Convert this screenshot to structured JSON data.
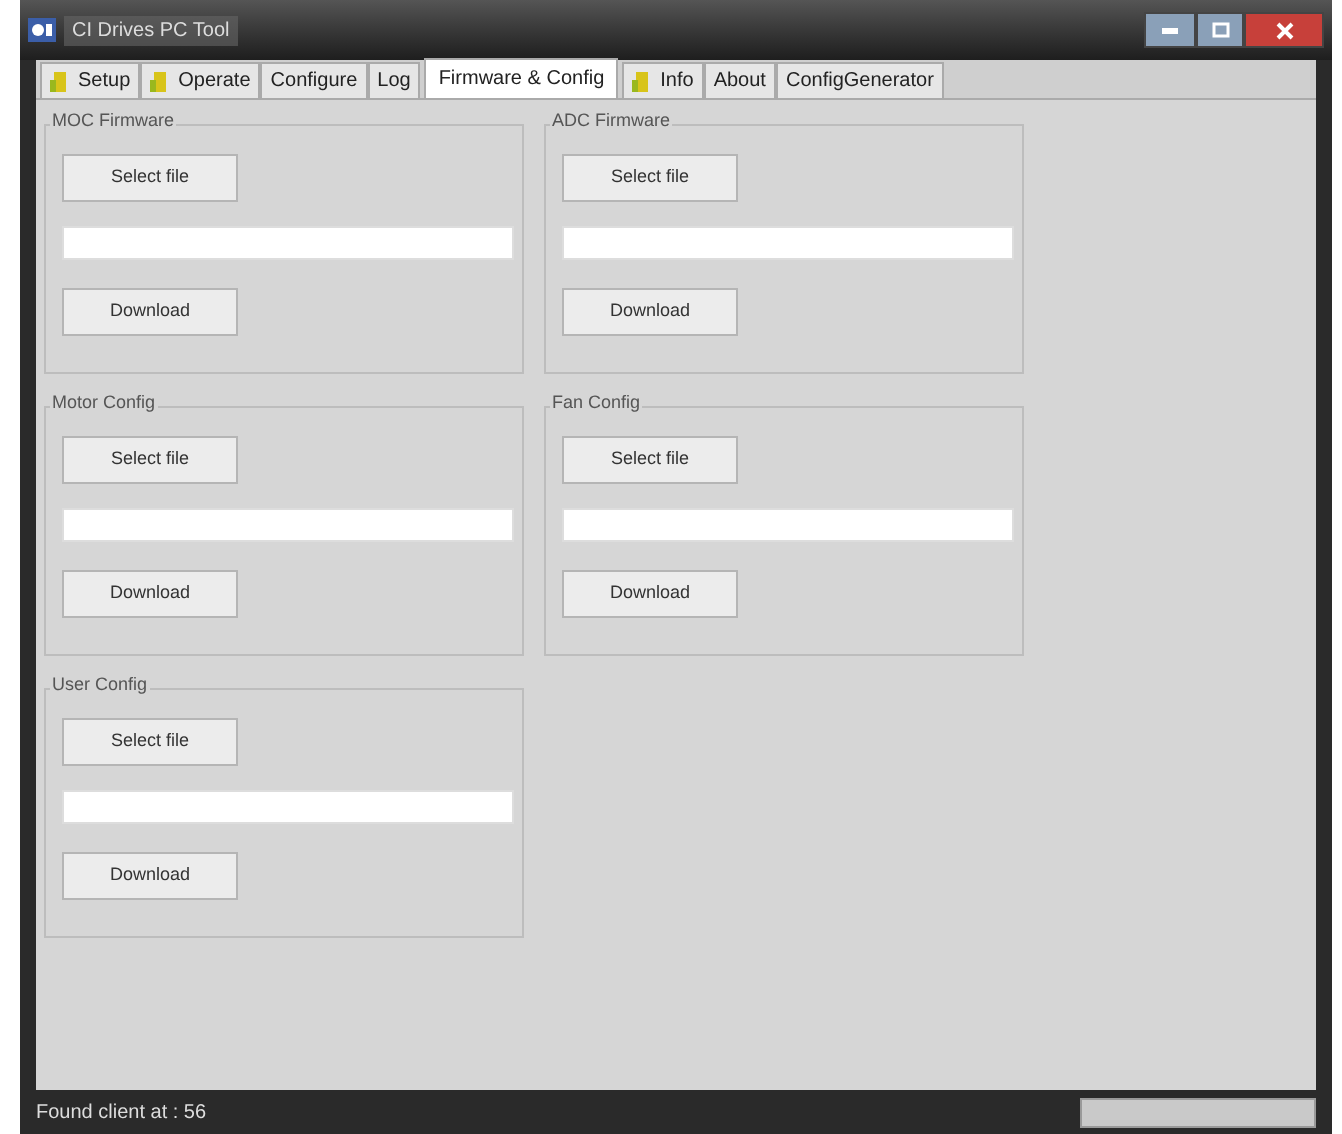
{
  "window": {
    "title": "CI Drives PC Tool"
  },
  "tabs": [
    {
      "label": "Setup",
      "selected": false,
      "icon": true
    },
    {
      "label": "Operate",
      "selected": false,
      "icon": true
    },
    {
      "label": "Configure",
      "selected": false,
      "icon": false
    },
    {
      "label": "Log",
      "selected": false,
      "icon": false
    },
    {
      "label": "Firmware & Config",
      "selected": true,
      "icon": false
    },
    {
      "label": "Info",
      "selected": false,
      "icon": true
    },
    {
      "label": "About",
      "selected": false,
      "icon": false
    },
    {
      "label": "ConfigGenerator",
      "selected": false,
      "icon": false
    }
  ],
  "panels": [
    {
      "title": "MOC Firmware",
      "select_button": "Select file",
      "download_button": "Download"
    },
    {
      "title": "ADC Firmware",
      "select_button": "Select file",
      "download_button": "Download"
    },
    {
      "title": "Motor Config",
      "select_button": "Select file",
      "download_button": "Download"
    },
    {
      "title": "Fan Config",
      "select_button": "Select file",
      "download_button": "Download"
    },
    {
      "title": "User Config",
      "select_button": "Select file",
      "download_button": "Download"
    }
  ],
  "status_bar": {
    "text": "Found client at : 56",
    "level": 0
  }
}
